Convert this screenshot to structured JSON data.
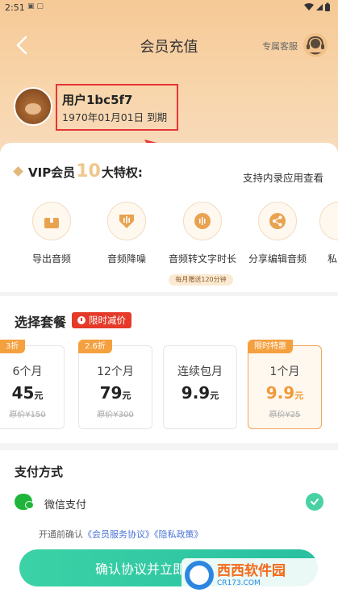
{
  "status_bar": {
    "time": "2:51",
    "left_icons": "▣ ▢"
  },
  "header": {
    "title": "会员充值",
    "service_label": "专属客服"
  },
  "user": {
    "name": "用户1bc5f7",
    "expire": "1970年01月01日 到期"
  },
  "vip": {
    "prefix": "VIP会员",
    "count": "10",
    "suffix": "大特权:",
    "support_link": "支持内录应用查看"
  },
  "features": [
    {
      "label": "导出音频",
      "icon": "export-icon"
    },
    {
      "label": "音频降噪",
      "icon": "noise-reduction-icon"
    },
    {
      "label": "音频转文字时长",
      "icon": "speech-to-text-icon"
    },
    {
      "label": "分享编辑音频",
      "icon": "share-icon"
    },
    {
      "label": "私",
      "icon": "privacy-icon"
    }
  ],
  "feature_badge": "每月赠送120分钟",
  "plans_section": {
    "title": "选择套餐",
    "limited_label": "限时减价"
  },
  "plans": [
    {
      "tag": "3折",
      "name": "6个月",
      "price": "45",
      "unit": "元",
      "original": "原价¥150",
      "selected": false
    },
    {
      "tag": "2.6折",
      "name": "12个月",
      "price": "79",
      "unit": "元",
      "original": "原价¥300",
      "selected": false
    },
    {
      "tag": "",
      "name": "连续包月",
      "price": "9.9",
      "unit": "元",
      "original": "",
      "selected": false
    },
    {
      "tag": "限时特惠",
      "name": "1个月",
      "price": "9.9",
      "unit": "元",
      "original": "原价¥25",
      "selected": true
    }
  ],
  "payment": {
    "title": "支付方式",
    "method": "微信支付"
  },
  "agreement": {
    "prefix": "开通前确认",
    "service_link": "《会员服务协议》",
    "privacy_link": "《隐私政策》"
  },
  "confirm_button": "确认协议并立即",
  "watermark": {
    "big": "西西软件园",
    "small": "CR173.COM"
  },
  "colors": {
    "accent": "#f19a3a",
    "confirm": "#2fc8a3",
    "highlight": "#e53535"
  }
}
